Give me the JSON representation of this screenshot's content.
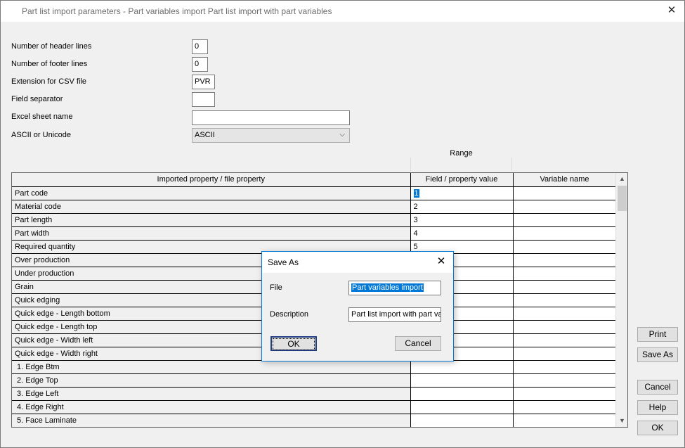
{
  "window": {
    "title": "Part list import parameters - Part variables import Part list import with part variables",
    "close_glyph": "✕"
  },
  "form": {
    "header_lines_label": "Number of header lines",
    "header_lines_value": "0",
    "footer_lines_label": "Number of footer lines",
    "footer_lines_value": "0",
    "csv_ext_label": "Extension for CSV file",
    "csv_ext_value": "PVR",
    "field_sep_label": "Field separator",
    "field_sep_value": "",
    "excel_sheet_label": "Excel sheet name",
    "excel_sheet_value": "",
    "encoding_label": "ASCII or Unicode",
    "encoding_value": "ASCII"
  },
  "grid": {
    "range_label": "Range",
    "columns": [
      "Imported property / file property",
      "Field / property value",
      "Variable name"
    ],
    "rows": [
      {
        "property": "Part code",
        "value": "1",
        "variable": ""
      },
      {
        "property": "Material code",
        "value": "2",
        "variable": ""
      },
      {
        "property": "Part length",
        "value": "3",
        "variable": ""
      },
      {
        "property": "Part width",
        "value": "4",
        "variable": ""
      },
      {
        "property": "Required quantity",
        "value": "5",
        "variable": ""
      },
      {
        "property": "Over production",
        "value": "",
        "variable": ""
      },
      {
        "property": "Under production",
        "value": "",
        "variable": ""
      },
      {
        "property": "Grain",
        "value": "",
        "variable": ""
      },
      {
        "property": "Quick edging",
        "value": "",
        "variable": ""
      },
      {
        "property": "Quick edge - Length bottom",
        "value": "",
        "variable": ""
      },
      {
        "property": "Quick edge - Length top",
        "value": "",
        "variable": ""
      },
      {
        "property": "Quick edge - Width left",
        "value": "",
        "variable": ""
      },
      {
        "property": "Quick edge - Width right",
        "value": "",
        "variable": ""
      },
      {
        "property": " 1. Edge Btm",
        "value": "",
        "variable": ""
      },
      {
        "property": " 2. Edge Top",
        "value": "",
        "variable": ""
      },
      {
        "property": " 3. Edge Left",
        "value": "",
        "variable": ""
      },
      {
        "property": " 4. Edge Right",
        "value": "",
        "variable": ""
      },
      {
        "property": " 5. Face Laminate",
        "value": "",
        "variable": ""
      }
    ]
  },
  "buttons": {
    "print": "Print",
    "save_as": "Save As",
    "cancel": "Cancel",
    "help": "Help",
    "ok": "OK"
  },
  "dialog": {
    "title": "Save As",
    "file_label": "File",
    "file_value": "Part variables import",
    "description_label": "Description",
    "description_value": "Part list import with part var",
    "ok": "OK",
    "cancel": "Cancel"
  },
  "icons": {
    "scroll_up": "▲",
    "scroll_down": "▼",
    "dropdown": "⌵"
  }
}
